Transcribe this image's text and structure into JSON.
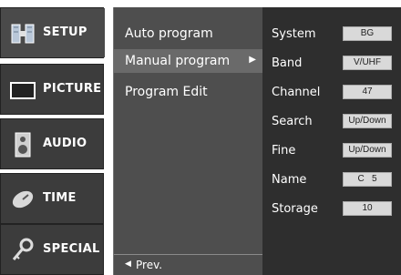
{
  "categories": [
    {
      "label": "SETUP",
      "icon": "satellite-icon"
    },
    {
      "label": "PICTURE",
      "icon": "monitor-icon"
    },
    {
      "label": "AUDIO",
      "icon": "speaker-icon"
    },
    {
      "label": "TIME",
      "icon": "clock-icon"
    },
    {
      "label": "SPECIAL",
      "icon": "key-icon"
    }
  ],
  "submenu": {
    "items": [
      {
        "label": "Auto program"
      },
      {
        "label": "Manual program",
        "arrow": "▶"
      },
      {
        "label": "Program Edit"
      }
    ],
    "prev_arrow": "◀",
    "prev_label": "Prev."
  },
  "settings": [
    {
      "name": "System",
      "value": "BG"
    },
    {
      "name": "Band",
      "value": "V/UHF"
    },
    {
      "name": "Channel",
      "value": "47"
    },
    {
      "name": "Search",
      "value": "Up/Down"
    },
    {
      "name": "Fine",
      "value": "Up/Down"
    },
    {
      "name": "Name",
      "value": "C   5"
    },
    {
      "name": "Storage",
      "value": "10"
    }
  ],
  "colors": {
    "panel_dark": "#2e2e2e",
    "panel_mid": "#4e4e4e",
    "highlight": "#6a6a6a",
    "value_box": "#d9d9d9"
  }
}
